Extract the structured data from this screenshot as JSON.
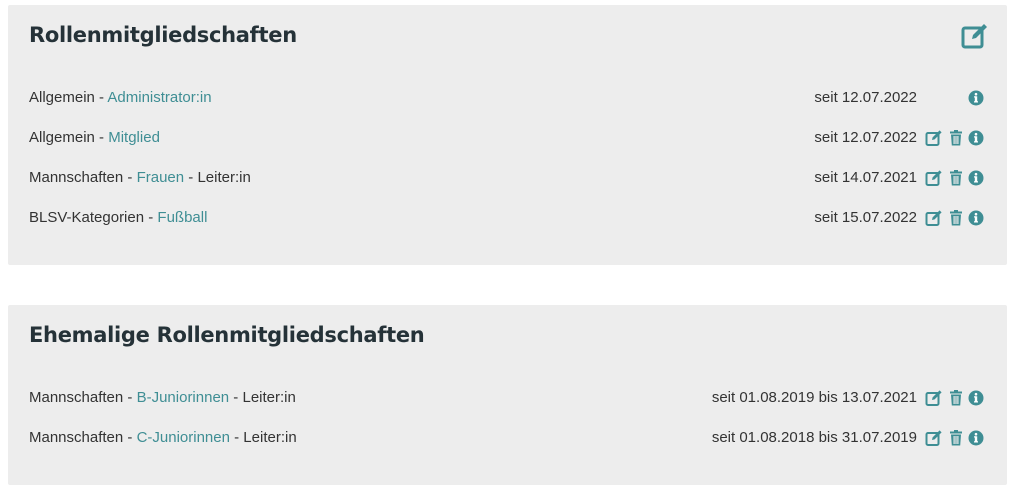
{
  "colors": {
    "accent": "#3f8e94",
    "card_bg": "#ededed",
    "title": "#253238",
    "text": "#333333"
  },
  "current": {
    "title": "Rollenmitgliedschaften",
    "edit_icon": "edit-icon",
    "rows": [
      {
        "group": "Allgemein",
        "sep1": " - ",
        "role": "Administrator:in",
        "suffix": "",
        "date": "seit 12.07.2022",
        "actions": [
          "info-icon"
        ]
      },
      {
        "group": "Allgemein",
        "sep1": " - ",
        "role": "Mitglied",
        "suffix": "",
        "date": "seit 12.07.2022",
        "actions": [
          "edit-icon",
          "trash-icon",
          "info-icon"
        ]
      },
      {
        "group": "Mannschaften",
        "sep1": " - ",
        "role": "Frauen",
        "suffix": " - Leiter:in",
        "date": "seit 14.07.2021",
        "actions": [
          "edit-icon",
          "trash-icon",
          "info-icon"
        ]
      },
      {
        "group": "BLSV-Kategorien",
        "sep1": " - ",
        "role": "Fußball",
        "suffix": "",
        "date": "seit 15.07.2022",
        "actions": [
          "edit-icon",
          "trash-icon",
          "info-icon"
        ]
      }
    ]
  },
  "former": {
    "title": "Ehemalige Rollenmitgliedschaften",
    "rows": [
      {
        "group": "Mannschaften",
        "sep1": " - ",
        "role": "B-Juniorinnen",
        "suffix": " - Leiter:in",
        "date": "seit 01.08.2019 bis 13.07.2021",
        "actions": [
          "edit-icon",
          "trash-icon",
          "info-icon"
        ]
      },
      {
        "group": "Mannschaften",
        "sep1": " - ",
        "role": "C-Juniorinnen",
        "suffix": " - Leiter:in",
        "date": "seit 01.08.2018 bis 31.07.2019",
        "actions": [
          "edit-icon",
          "trash-icon",
          "info-icon"
        ]
      }
    ]
  }
}
